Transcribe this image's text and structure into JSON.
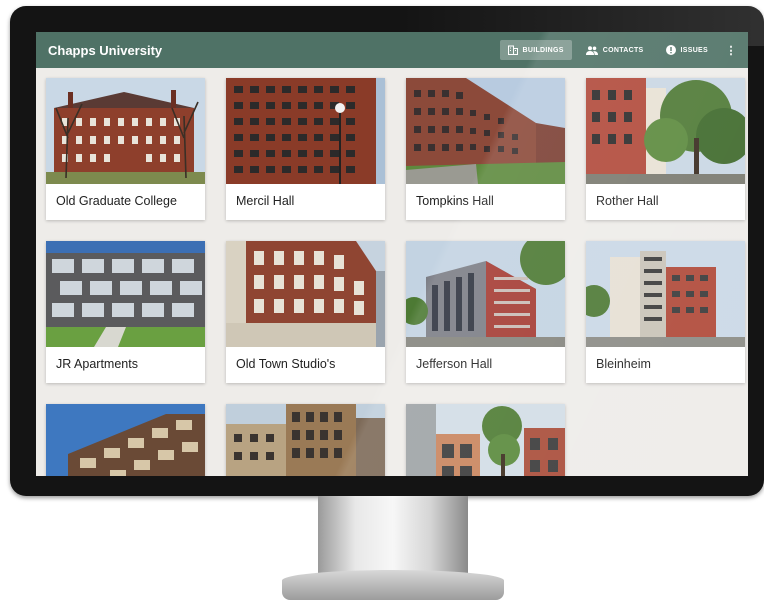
{
  "app": {
    "title": "Chapps University"
  },
  "nav": {
    "buildings": {
      "label": "BUILDINGS",
      "icon": "building-icon"
    },
    "contacts": {
      "label": "CONTACTS",
      "icon": "people-icon"
    },
    "issues": {
      "label": "ISSUES",
      "icon": "alert-icon"
    },
    "more_icon": "more-vert-icon"
  },
  "colors": {
    "appbar": "#4f7266",
    "screen_bg": "#eeece9",
    "card_bg": "#ffffff"
  },
  "buildings": [
    {
      "name": "Old Graduate College"
    },
    {
      "name": "Mercil Hall"
    },
    {
      "name": "Tompkins Hall"
    },
    {
      "name": "Rother Hall"
    },
    {
      "name": "JR Apartments"
    },
    {
      "name": "Old Town Studio's"
    },
    {
      "name": "Jefferson Hall"
    },
    {
      "name": "Bleinheim"
    },
    {
      "name": ""
    },
    {
      "name": ""
    },
    {
      "name": ""
    }
  ]
}
